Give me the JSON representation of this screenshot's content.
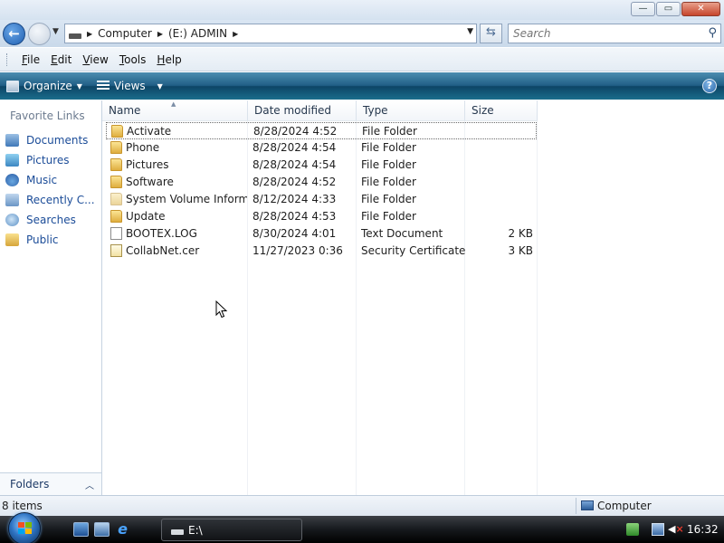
{
  "window": {
    "minimize_label": "—",
    "maximize_label": "▭",
    "close_label": "✕"
  },
  "addressbar": {
    "back_glyph": "←",
    "crumbs": [
      "Computer",
      "(E:) ADMIN"
    ],
    "search_placeholder": "Search"
  },
  "menu": [
    {
      "label": "File",
      "key": "F",
      "rest": "ile"
    },
    {
      "label": "Edit",
      "key": "E",
      "rest": "dit"
    },
    {
      "label": "View",
      "key": "V",
      "rest": "iew"
    },
    {
      "label": "Tools",
      "key": "T",
      "rest": "ools"
    },
    {
      "label": "Help",
      "key": "H",
      "rest": "elp"
    }
  ],
  "commandbar": {
    "organize_label": "Organize",
    "views_label": "Views",
    "help_glyph": "?"
  },
  "navpane": {
    "title": "Favorite Links",
    "items": [
      {
        "label": "Documents",
        "icon": "documents-icon"
      },
      {
        "label": "Pictures",
        "icon": "pictures-icon"
      },
      {
        "label": "Music",
        "icon": "music-icon"
      },
      {
        "label": "Recently C...",
        "icon": "recently-changed-icon"
      },
      {
        "label": "Searches",
        "icon": "searches-icon"
      },
      {
        "label": "Public",
        "icon": "public-icon"
      }
    ],
    "folders_label": "Folders"
  },
  "filelist": {
    "columns": [
      "Name",
      "Date modified",
      "Type",
      "Size"
    ],
    "rows": [
      {
        "name": "Activate",
        "date": "8/28/2024 4:52",
        "type": "File Folder",
        "size": "",
        "icon": "folder-icon"
      },
      {
        "name": "Phone",
        "date": "8/28/2024 4:54",
        "type": "File Folder",
        "size": "",
        "icon": "folder-icon"
      },
      {
        "name": "Pictures",
        "date": "8/28/2024 4:54",
        "type": "File Folder",
        "size": "",
        "icon": "folder-icon"
      },
      {
        "name": "Software",
        "date": "8/28/2024 4:52",
        "type": "File Folder",
        "size": "",
        "icon": "folder-icon"
      },
      {
        "name": "System Volume Inform...",
        "date": "8/12/2024 4:33",
        "type": "File Folder",
        "size": "",
        "icon": "system-folder-icon"
      },
      {
        "name": "Update",
        "date": "8/28/2024 4:53",
        "type": "File Folder",
        "size": "",
        "icon": "folder-icon"
      },
      {
        "name": "BOOTEX.LOG",
        "date": "8/30/2024 4:01",
        "type": "Text Document",
        "size": "2 KB",
        "icon": "text-document-icon"
      },
      {
        "name": "CollabNet.cer",
        "date": "11/27/2023 0:36",
        "type": "Security Certificate",
        "size": "3 KB",
        "icon": "certificate-icon"
      }
    ]
  },
  "statusbar": {
    "item_count": "8 items",
    "location": "Computer"
  },
  "taskbar": {
    "task_label": "E:\\",
    "clock": "16:32"
  }
}
